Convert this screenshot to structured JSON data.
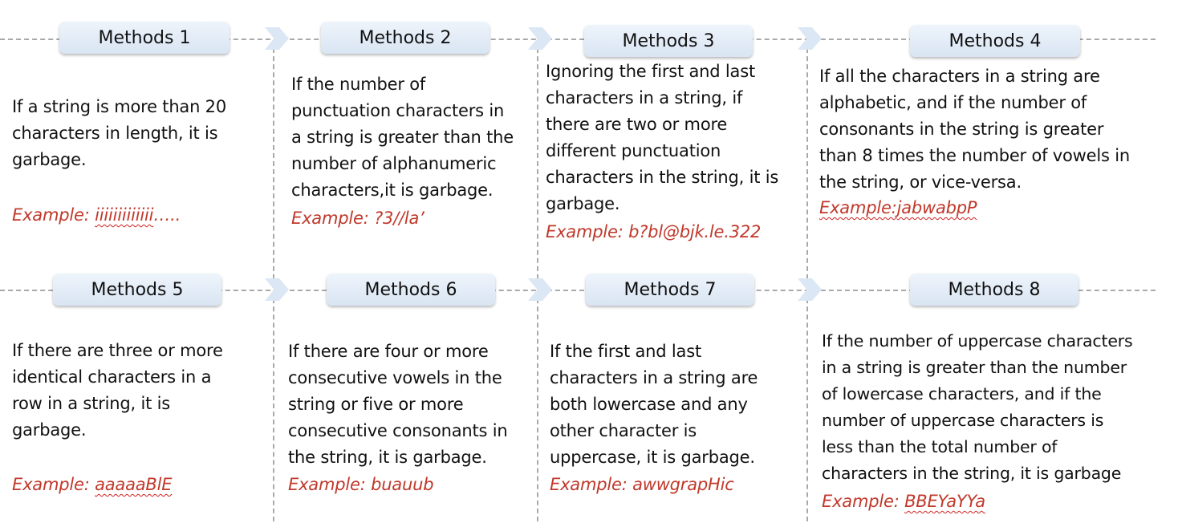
{
  "methods": [
    {
      "title": "Methods 1",
      "description": "If a string is more than 20\ncharacters in length, it is\ngarbage.",
      "example_prefix": "Example: ",
      "example_value": "iiiiiiiiiiiii",
      "example_suffix": "…..",
      "example_underlined": true
    },
    {
      "title": "Methods 2",
      "description": "If the number of\npunctuation characters in\na string is greater than the\nnumber of alphanumeric\ncharacters,it is garbage.",
      "example_prefix": "Example: ",
      "example_value": "?3//la’",
      "example_suffix": "",
      "example_underlined": false
    },
    {
      "title": "Methods 3",
      "description": "Ignoring the first and last\ncharacters in a string, if\nthere are two or more\ndifferent punctuation\ncharacters in the string, it is\ngarbage.",
      "example_prefix": "Example: ",
      "example_value": "b?bl@bjk.le.322",
      "example_suffix": "",
      "example_underlined": false
    },
    {
      "title": "Methods 4",
      "description": "If all the characters in a string are\nalphabetic, and if the number of\nconsonants in the string is greater\nthan 8 times the number of vowels in\nthe string, or vice-versa.",
      "example_prefix": "Example:",
      "example_value": "jabwabpP",
      "example_suffix": "",
      "example_underlined": true
    },
    {
      "title": "Methods 5",
      "description": "If there are three or more\nidentical characters in a\nrow in a string, it is\ngarbage.",
      "example_prefix": "Example: ",
      "example_value": "aaaaaBlE",
      "example_suffix": "",
      "example_underlined": true
    },
    {
      "title": "Methods 6",
      "description": "If there are four or more\nconsecutive vowels in the\nstring or five or more\nconsecutive consonants in\nthe string, it is garbage.",
      "example_prefix": "Example: ",
      "example_value": "buauub",
      "example_suffix": "",
      "example_underlined": false
    },
    {
      "title": "Methods 7",
      "description": "If the first and last\ncharacters in a string are\nboth lowercase and any\nother character is\nuppercase, it is garbage.",
      "example_prefix": "Example: ",
      "example_value": "awwgrapHic",
      "example_suffix": "",
      "example_underlined": false
    },
    {
      "title": "Methods 8",
      "description": "If the number of uppercase characters\nin a string is greater than the number\nof lowercase characters, and if the\nnumber of uppercase characters is\nless than the total number of\ncharacters in the string, it is garbage",
      "example_prefix": "Example: ",
      "example_value": "BBEYaYYa",
      "example_suffix": "",
      "example_underlined": true
    }
  ],
  "colors": {
    "pill_fill": "#dce7f4",
    "chevron": "#dbe7f4",
    "dashes": "#a9a9a9",
    "example_text": "#c0392b",
    "squiggle": "#d02020"
  }
}
